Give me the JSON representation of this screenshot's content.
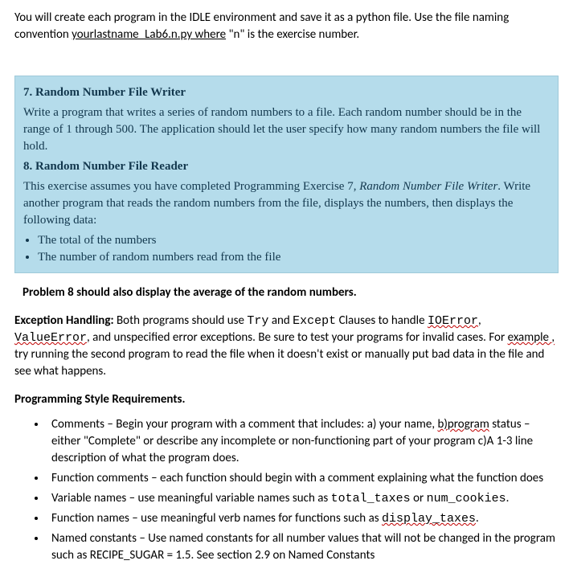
{
  "intro": {
    "part1": "You will create each program in the IDLE environment and save it as a python file.  Use the file naming convention ",
    "filename": "yourlastname_Lab6.n.py  where",
    "part2": " \"n\" is the exercise number."
  },
  "ex7": {
    "heading": "7.  Random Number File Writer",
    "body": "Write a program that writes a series of random numbers to a file. Each random number should be in the range of 1 through 500. The application should let the user specify how many random numbers the file will hold."
  },
  "ex8": {
    "heading": "8.  Random Number File Reader",
    "body_a": "This exercise assumes you have completed Programming Exercise 7, ",
    "body_italic": "Random Number File Writer",
    "body_b": ". Write another program that reads the random numbers from the file, displays the numbers, then displays the following data:",
    "bullets": [
      "The total of the numbers",
      "The number of random numbers read from the file"
    ]
  },
  "after_note": "Problem 8 should also display the average of the random numbers.",
  "exc": {
    "title": "Exception Handling:",
    "p1a": "   Both programs should use ",
    "try": "Try",
    "p1b": "  and ",
    "except": "Except",
    "p1c": " Clauses to handle ",
    "ioerror": "IOError",
    "p2a": ", ",
    "valueerror": "ValueError",
    "p2b": ", and unspecified error exceptions.   Be sure to test your programs for invalid cases.  For ",
    "example": "example ,",
    "p2c": "  try running the second program to read the file when it doesn't exist or manually put bad data in the file and see what happens."
  },
  "style": {
    "title": "Programming Style Requirements.",
    "b1a": "Comments – Begin your program with a comment that includes: a) your name, ",
    "b1_sq": "b)program",
    "b1b": " status – either \"Complete\" or describe any incomplete or non-functioning part of your program c)A 1-3 line description of what the program does.",
    "b2": "Function comments – each function should begin with a comment explaining what the function does",
    "b3a": "Variable names – use meaningful variable names such as ",
    "b3_code1": "total_taxes",
    "b3b": " or ",
    "b3_code2": "num_cookies",
    "b3c": ".",
    "b4a": "Function names – use meaningful verb names for functions such as ",
    "b4_code": "display_taxes",
    "b4b": ".",
    "b5": "Named constants – Use named constants for all number values that will not be changed in the program such as RECIPE_SUGAR = 1.5.   See section 2.9 on Named Constants"
  }
}
